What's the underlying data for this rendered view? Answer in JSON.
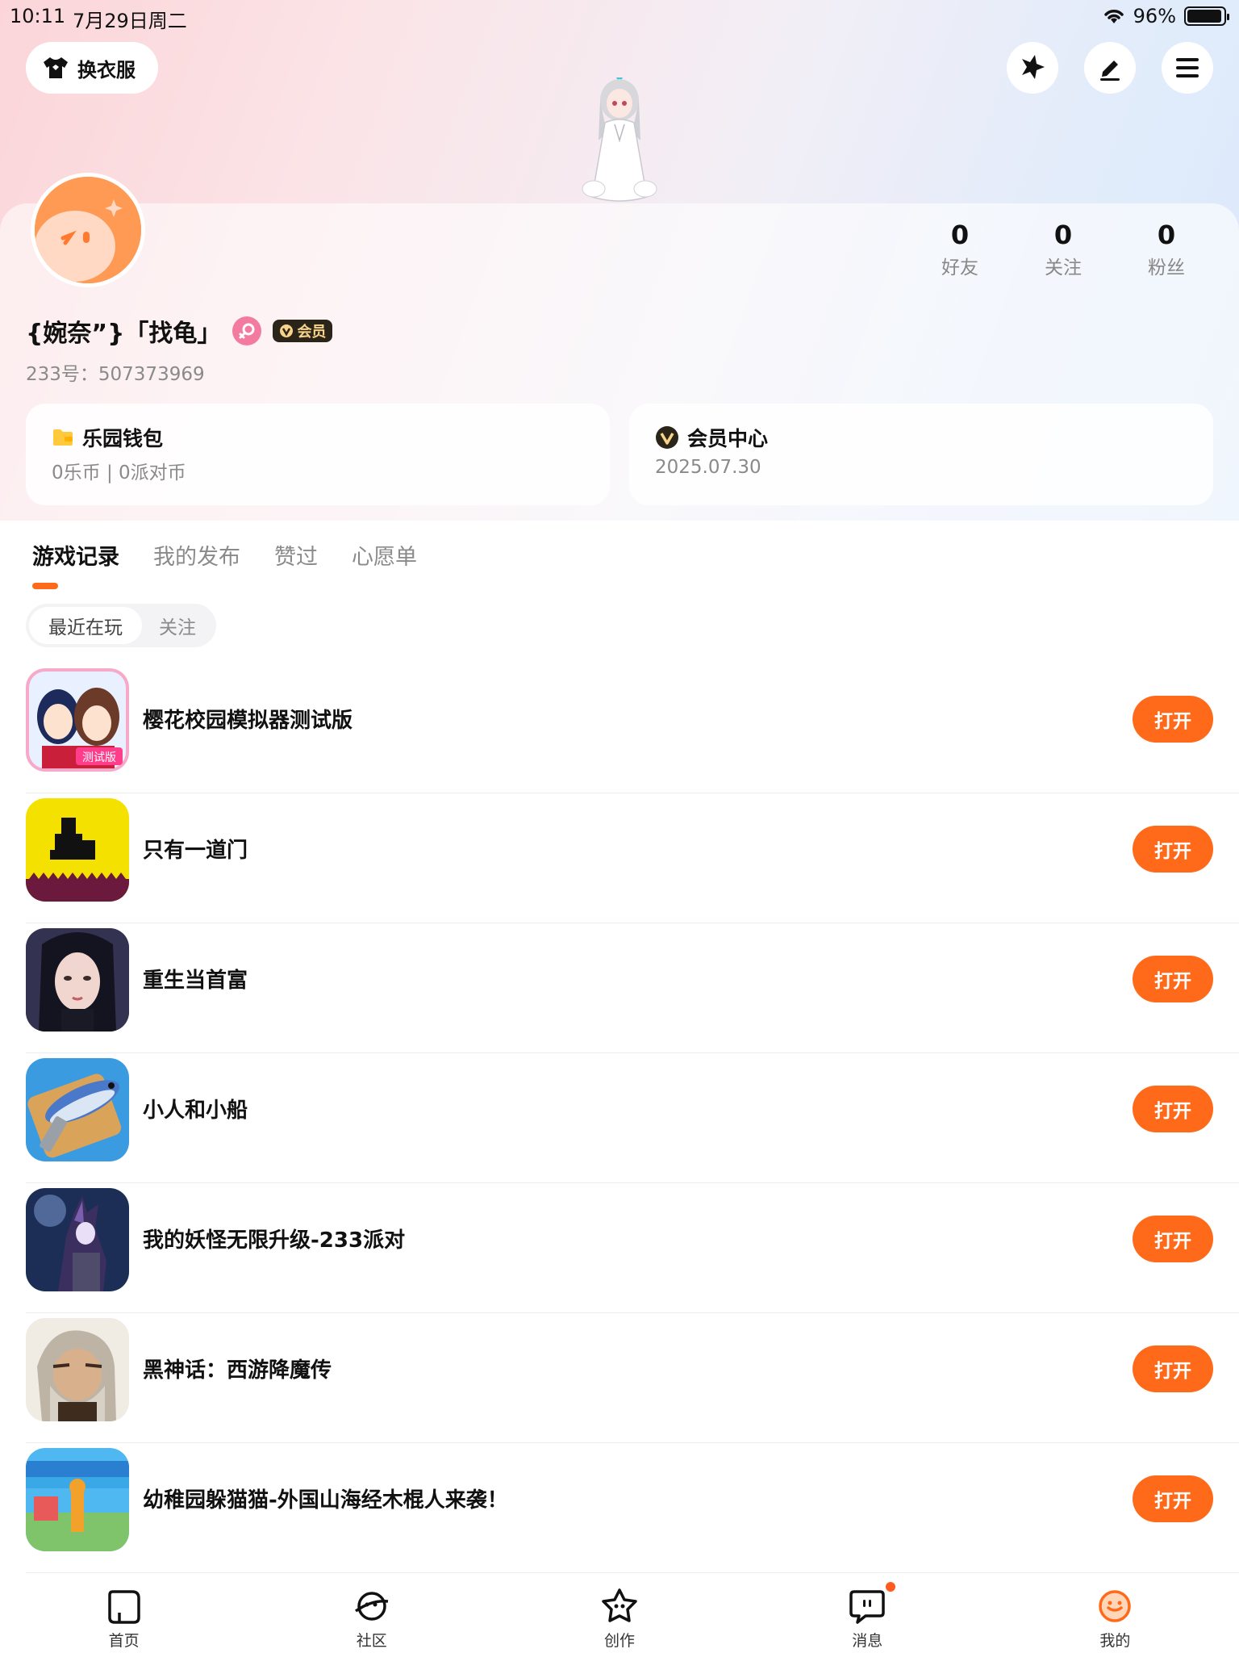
{
  "status_bar": {
    "time": "10:11",
    "date": "7月29日周二",
    "battery": "96%",
    "battery_level": 0.96
  },
  "header": {
    "wardrobe_label": "换衣服",
    "icons": [
      "star-burst-icon",
      "edit-pen-icon",
      "menu-icon"
    ]
  },
  "profile": {
    "stats": [
      {
        "value": "0",
        "label": "好友"
      },
      {
        "value": "0",
        "label": "关注"
      },
      {
        "value": "0",
        "label": "粉丝"
      }
    ],
    "username": "{婉奈”}「找龟」",
    "vip_label": "会员",
    "uid": "233号：507373969"
  },
  "cards": {
    "wallet": {
      "title": "乐园钱包",
      "sub": "0乐币 | 0派对币"
    },
    "vip": {
      "title": "会员中心",
      "sub": "2025.07.30"
    }
  },
  "tabs": [
    "游戏记录",
    "我的发布",
    "赞过",
    "心愿单"
  ],
  "subtabs": [
    "最近在玩",
    "关注"
  ],
  "games": [
    {
      "name": "樱花校园模拟器测试版",
      "button": "打开",
      "icon": "sakura-school-icon"
    },
    {
      "name": "只有一道门",
      "button": "打开",
      "icon": "one-door-icon"
    },
    {
      "name": "重生当首富",
      "button": "打开",
      "icon": "rebirth-rich-icon"
    },
    {
      "name": "小人和小船",
      "button": "打开",
      "icon": "fish-boat-icon"
    },
    {
      "name": "我的妖怪无限升级-233派对",
      "button": "打开",
      "icon": "monster-upgrade-icon"
    },
    {
      "name": "黑神话：西游降魔传",
      "button": "打开",
      "icon": "black-myth-icon"
    },
    {
      "name": "幼稚园躲猫猫-外国山海经木棍人来袭！",
      "button": "打开",
      "icon": "kindergarten-hide-icon"
    }
  ],
  "tabbar": [
    {
      "label": "首页",
      "icon": "home-icon"
    },
    {
      "label": "社区",
      "icon": "community-icon"
    },
    {
      "label": "创作",
      "icon": "create-icon"
    },
    {
      "label": "消息",
      "icon": "message-icon"
    },
    {
      "label": "我的",
      "icon": "me-icon"
    }
  ],
  "colors": {
    "accent": "#ff6a1a",
    "text": "#111111",
    "muted": "#8a8a8a"
  }
}
